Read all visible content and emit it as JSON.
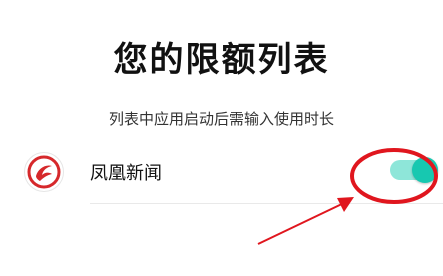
{
  "page": {
    "title": "您的限额列表",
    "subtitle": "列表中应用启动后需输入使用时长"
  },
  "apps": [
    {
      "label": "凤凰新闻",
      "icon": "phoenix-logo-icon",
      "toggle_on": true
    }
  ],
  "colors": {
    "toggle_track": "#8ee6d9",
    "toggle_knob": "#17c8b0",
    "annotation_red": "#e0161e",
    "logo_red": "#d6282b"
  }
}
